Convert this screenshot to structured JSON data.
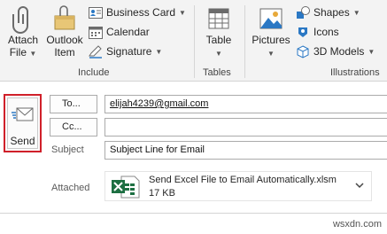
{
  "ribbon": {
    "attach_file": {
      "line1": "Attach",
      "line2": "File"
    },
    "outlook_item": {
      "line1": "Outlook",
      "line2": "Item"
    },
    "business_card": "Business Card",
    "calendar": "Calendar",
    "signature": "Signature",
    "table": "Table",
    "pictures": "Pictures",
    "shapes": "Shapes",
    "icons": "Icons",
    "models_3d": "3D Models",
    "groups": {
      "include": "Include",
      "tables": "Tables",
      "illustrations": "Illustrations"
    },
    "colors": {
      "icon_blue": "#2b78c4",
      "icon_gray": "#6b6b6b"
    }
  },
  "compose": {
    "send_label": "Send",
    "to_button": "To...",
    "cc_button": "Cc...",
    "subject_label": "Subject",
    "to_value": "elijah4239@gmail.com",
    "cc_value": "",
    "subject_value": "Subject Line for Email",
    "attached_label": "Attached",
    "attachment": {
      "name": "Send Excel File to Email Automatically.xlsm",
      "size": "17 KB"
    },
    "body_text": "                     ",
    "colors": {
      "send_highlight": "#d0202a",
      "excel_green": "#1d6f42"
    }
  },
  "watermark": "wsxdn.com"
}
